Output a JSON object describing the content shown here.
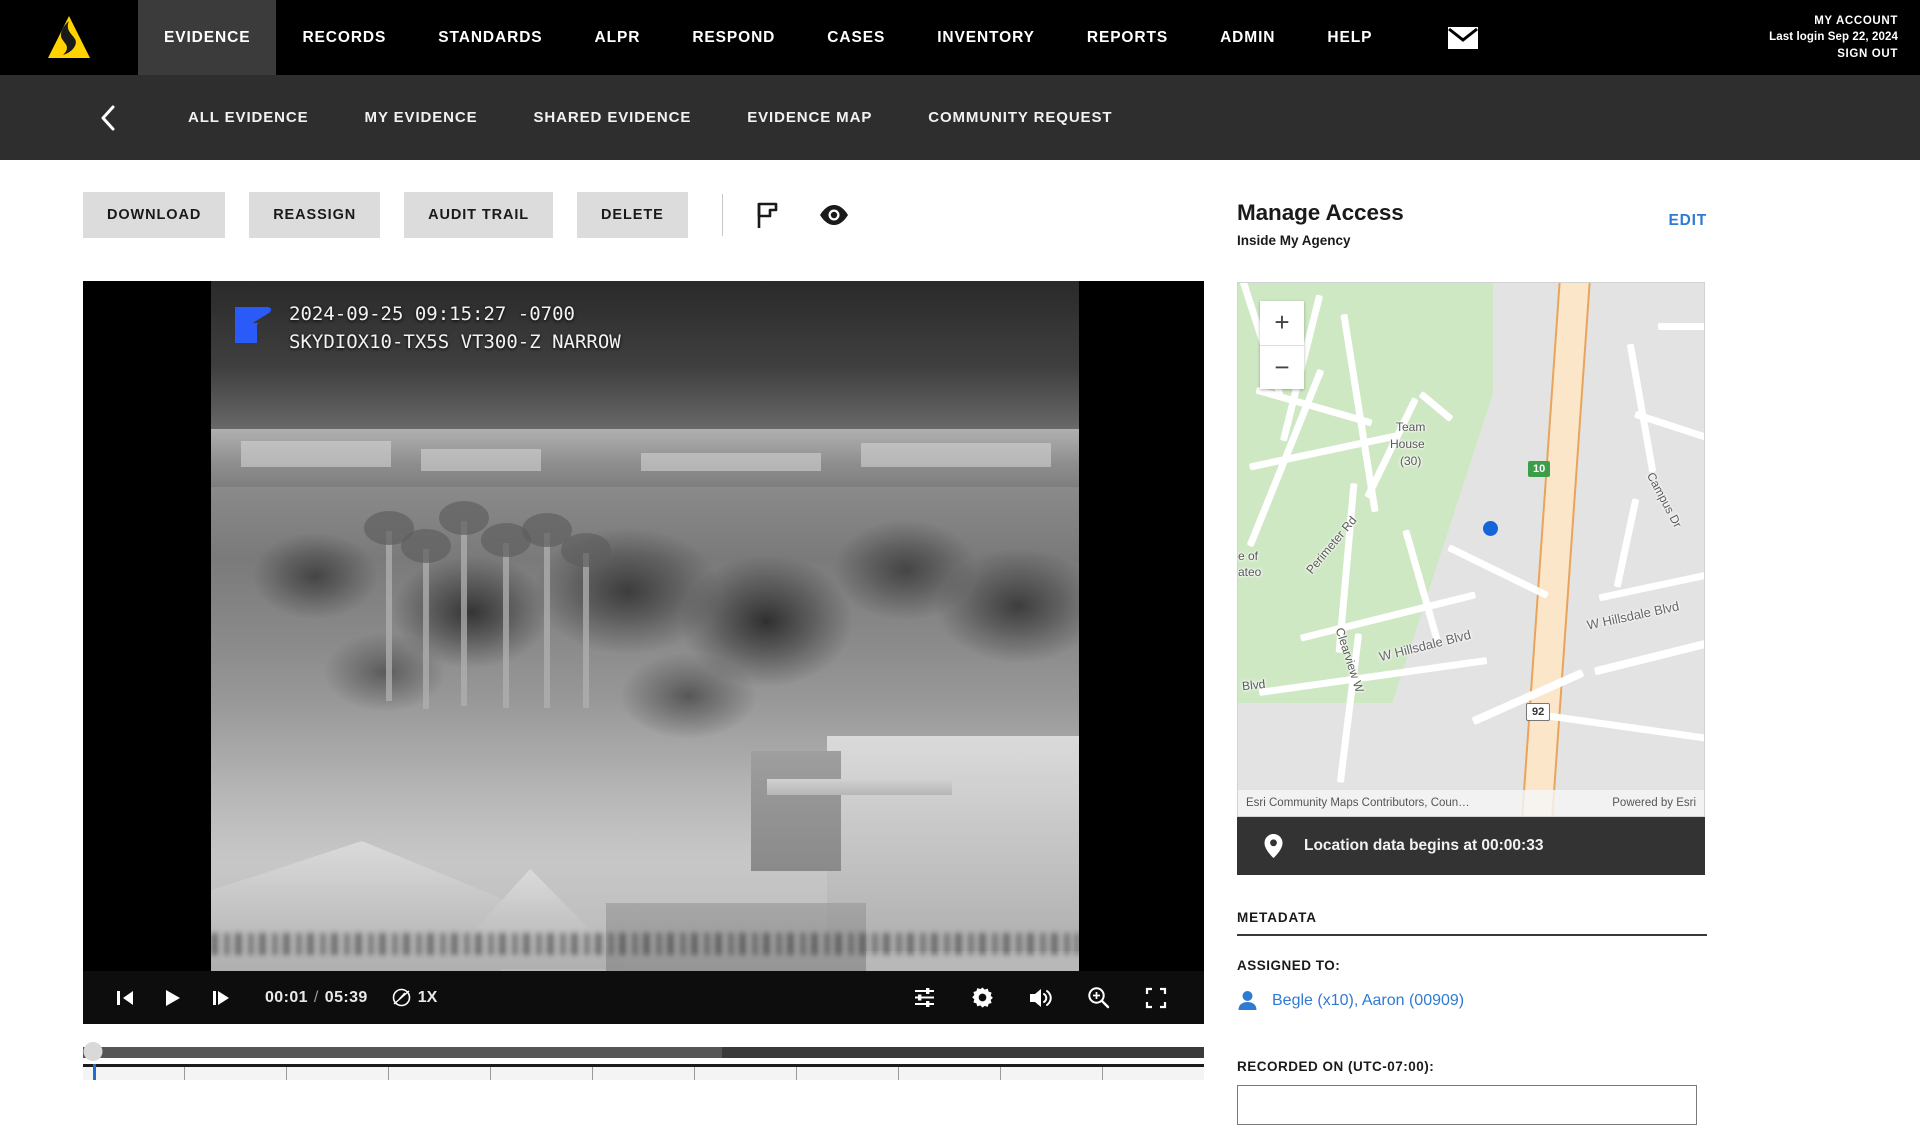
{
  "header": {
    "logo_icon": "axon-logo-icon",
    "logo_color": "#FFD200",
    "nav": [
      {
        "label": "EVIDENCE",
        "active": true
      },
      {
        "label": "RECORDS",
        "active": false
      },
      {
        "label": "STANDARDS",
        "active": false
      },
      {
        "label": "ALPR",
        "active": false
      },
      {
        "label": "RESPOND",
        "active": false
      },
      {
        "label": "CASES",
        "active": false
      },
      {
        "label": "INVENTORY",
        "active": false
      },
      {
        "label": "REPORTS",
        "active": false
      },
      {
        "label": "ADMIN",
        "active": false
      },
      {
        "label": "HELP",
        "active": false
      }
    ],
    "mail_icon": "mail-icon",
    "account": {
      "my_account": "MY ACCOUNT",
      "last_login": "Last login Sep 22, 2024",
      "sign_out": "SIGN OUT"
    }
  },
  "subnav": {
    "back_icon": "chevron-left-icon",
    "items": [
      {
        "label": "ALL EVIDENCE"
      },
      {
        "label": "MY EVIDENCE"
      },
      {
        "label": "SHARED EVIDENCE"
      },
      {
        "label": "EVIDENCE MAP"
      },
      {
        "label": "COMMUNITY REQUEST"
      }
    ]
  },
  "toolbar": {
    "buttons": [
      {
        "label": "DOWNLOAD"
      },
      {
        "label": "REASSIGN"
      },
      {
        "label": "AUDIT TRAIL"
      },
      {
        "label": "DELETE"
      }
    ],
    "icons": [
      {
        "name": "flag-icon"
      },
      {
        "name": "eye-icon"
      }
    ]
  },
  "video": {
    "overlay": {
      "logo_icon": "skydio-logo-icon",
      "logo_color": "#2C5BF5",
      "line1": "2024-09-25 09:15:27 -0700",
      "line2": "SKYDIOX10-TX5S VT300-Z NARROW"
    },
    "controls": {
      "step_back_icon": "step-backward-icon",
      "play_icon": "play-icon",
      "step_forward_icon": "step-forward-icon",
      "current_time": "00:01",
      "separator": "/",
      "duration": "05:39",
      "speed_icon": "speed-gauge-icon",
      "speed": "1X",
      "right_icons": [
        {
          "name": "adjustments-icon"
        },
        {
          "name": "gear-icon"
        },
        {
          "name": "volume-icon"
        },
        {
          "name": "zoom-in-icon"
        },
        {
          "name": "fullscreen-icon"
        }
      ]
    },
    "scrubber": {
      "position_percent": 0.9,
      "buffered_percent": 57,
      "filmstrip_cells": 11
    }
  },
  "sidebar": {
    "manage_access": {
      "title": "Manage Access",
      "subtitle": "Inside My Agency",
      "edit_label": "EDIT"
    },
    "map": {
      "zoom_in": "+",
      "zoom_out": "−",
      "labels": [
        {
          "text": "Team"
        },
        {
          "text": "House"
        },
        {
          "text": "(30)"
        },
        {
          "text": "Campus Dr"
        },
        {
          "text": "Perimeter Rd"
        },
        {
          "text": "Clearview W"
        },
        {
          "text": "W Hillsdale Blvd"
        },
        {
          "text": "W Hillsdale Blvd"
        },
        {
          "text": "Blvd"
        },
        {
          "text": "e of"
        },
        {
          "text": "ateo"
        }
      ],
      "shields": [
        {
          "text": "10",
          "type": "green"
        },
        {
          "text": "92",
          "type": "white"
        }
      ],
      "attribution_left": "Esri Community Maps Contributors, Coun…",
      "attribution_right": "Powered by Esri",
      "marker_icon": "map-marker-dot"
    },
    "location_bar": {
      "pin_icon": "location-pin-icon",
      "text": "Location data begins at 00:00:33"
    },
    "metadata": {
      "section_title": "METADATA",
      "assigned_to_label": "ASSIGNED TO:",
      "assignee_icon": "person-icon",
      "assignee": "Begle (x10), Aaron (00909)",
      "recorded_on_label": "RECORDED ON (UTC-07:00):",
      "recorded_on_value": ""
    }
  }
}
